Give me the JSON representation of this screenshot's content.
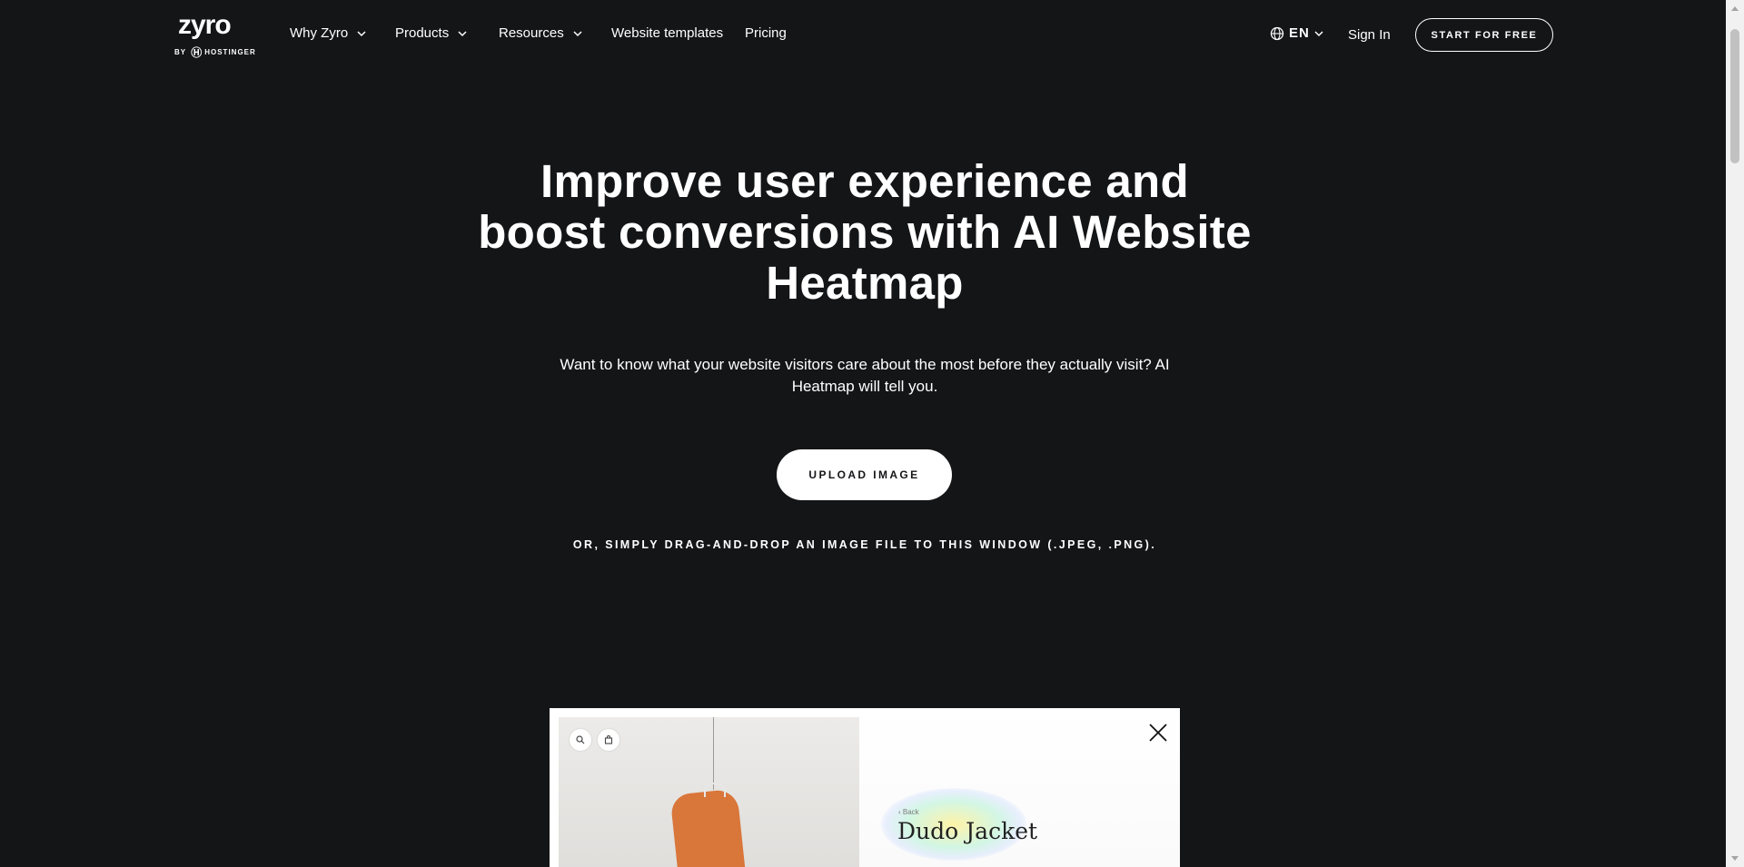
{
  "brand": {
    "name": "zyro",
    "sub_by": "BY",
    "sub_company": "HOSTINGER"
  },
  "nav": {
    "items": [
      {
        "label": "Why Zyro",
        "dropdown": true
      },
      {
        "label": "Products",
        "dropdown": true
      },
      {
        "label": "Resources",
        "dropdown": true
      },
      {
        "label": "Website templates",
        "dropdown": false
      },
      {
        "label": "Pricing",
        "dropdown": false
      }
    ],
    "language": "EN",
    "sign_in": "Sign In",
    "cta": "START FOR FREE"
  },
  "hero": {
    "title": "Improve user experience and boost conversions with AI Website Heatmap",
    "subtitle": "Want to know what your website visitors care about the most before they actually visit? AI Heatmap will tell you.",
    "upload_button": "UPLOAD IMAGE",
    "drag_hint": "OR, SIMPLY DRAG-AND-DROP AN IMAGE FILE TO THIS WINDOW (.JPEG, .PNG)."
  },
  "preview": {
    "back_label": "‹ Back",
    "product_title": "Dudo Jacket",
    "icons": [
      "search-icon",
      "bag-icon",
      "close-icon"
    ]
  },
  "colors": {
    "background": "#141517",
    "text": "#ffffff",
    "jacket": "#d9763a"
  }
}
